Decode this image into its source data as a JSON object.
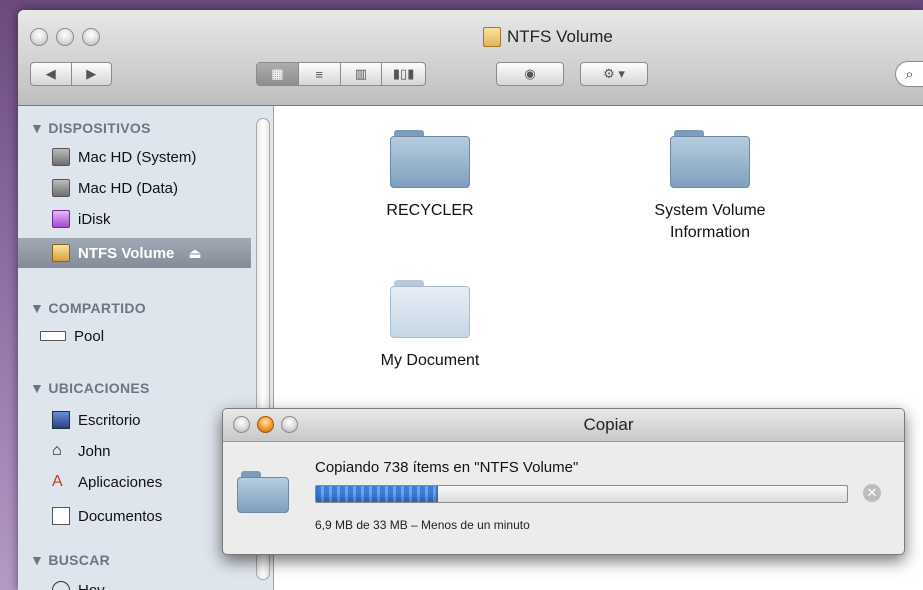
{
  "window": {
    "title": "NTFS Volume"
  },
  "sidebar": {
    "sections": [
      {
        "title": "▼ DISPOSITIVOS"
      },
      {
        "title": "▼ COMPARTIDO"
      },
      {
        "title": "▼ UBICACIONES"
      },
      {
        "title": "▼ BUSCAR"
      }
    ],
    "devices": [
      "Mac HD (System)",
      "Mac HD (Data)",
      "iDisk",
      "NTFS Volume"
    ],
    "shared": [
      "Pool"
    ],
    "places": [
      "Escritorio",
      "John",
      "Aplicaciones",
      "Documentos"
    ],
    "search": [
      "Hoy"
    ],
    "eject_glyph": "⏏"
  },
  "files": [
    {
      "name": "RECYCLER"
    },
    {
      "name": "System Volume Information"
    },
    {
      "name": "My Document"
    }
  ],
  "copy_dialog": {
    "title": "Copiar",
    "message": "Copiando 738 ítems en \"NTFS Volume\"",
    "progress": 0.23,
    "status": "6,9 MB de 33 MB – Menos de un minuto"
  }
}
